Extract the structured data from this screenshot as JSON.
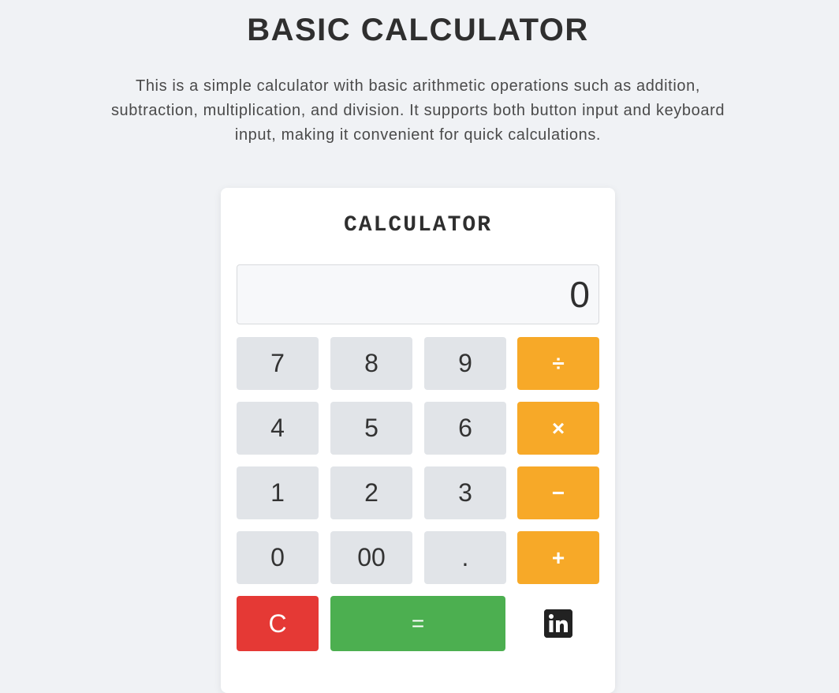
{
  "header": {
    "title": "BASIC CALCULATOR",
    "description": "This is a simple calculator with basic arithmetic operations such as addition, subtraction, multiplication, and division. It supports both button input and keyboard input, making it convenient for quick calculations."
  },
  "calculator": {
    "title": "CALCULATOR",
    "display_value": "0",
    "keys": {
      "seven": "7",
      "eight": "8",
      "nine": "9",
      "divide": "÷",
      "four": "4",
      "five": "5",
      "six": "6",
      "multiply": "×",
      "one": "1",
      "two": "2",
      "three": "3",
      "subtract": "−",
      "zero": "0",
      "double_zero": "00",
      "decimal": ".",
      "add": "+",
      "clear": "C",
      "equals": "="
    },
    "social_icon": "linkedin-icon"
  },
  "colors": {
    "background": "#f0f2f5",
    "operator": "#f7a928",
    "clear": "#e53935",
    "equals": "#4caf50",
    "digit": "#e1e4e8"
  }
}
